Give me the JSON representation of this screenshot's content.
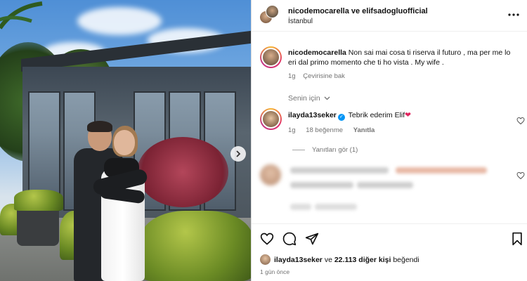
{
  "post": {
    "header": {
      "names": "nicodemocarella ve elifsadogluofficial",
      "location": "İstanbul",
      "more_icon": "more-horizontal-icon"
    },
    "caption": {
      "user": "nicodemocarella",
      "text": "Non sai mai cosa ti riserva il futuro , ma per me lo eri dal primo momento che ti ho vista . My wife .",
      "age": "1g",
      "translate": "Çevirisine bak"
    },
    "section_label": "Senin için",
    "comment1": {
      "user": "ilayda13seker",
      "text": "Tebrik ederim Elif",
      "emoji": "❤",
      "age": "1g",
      "likes": "18 beğenme",
      "reply": "Yanıtla",
      "view_replies": "Yanıtları gör (1)"
    },
    "likes": {
      "user": "ilayda13seker",
      "connector": "ve",
      "count": "22.113 diğer kişi",
      "suffix": "beğendi"
    },
    "time_ago": "1 gün önce",
    "colors": {
      "verified": "#0095f6",
      "heart": "#e0245e",
      "muted": "#737373"
    },
    "icons": [
      "heart-icon",
      "comment-icon",
      "share-icon",
      "bookmark-icon",
      "chevron-right-icon",
      "verified-icon"
    ]
  }
}
